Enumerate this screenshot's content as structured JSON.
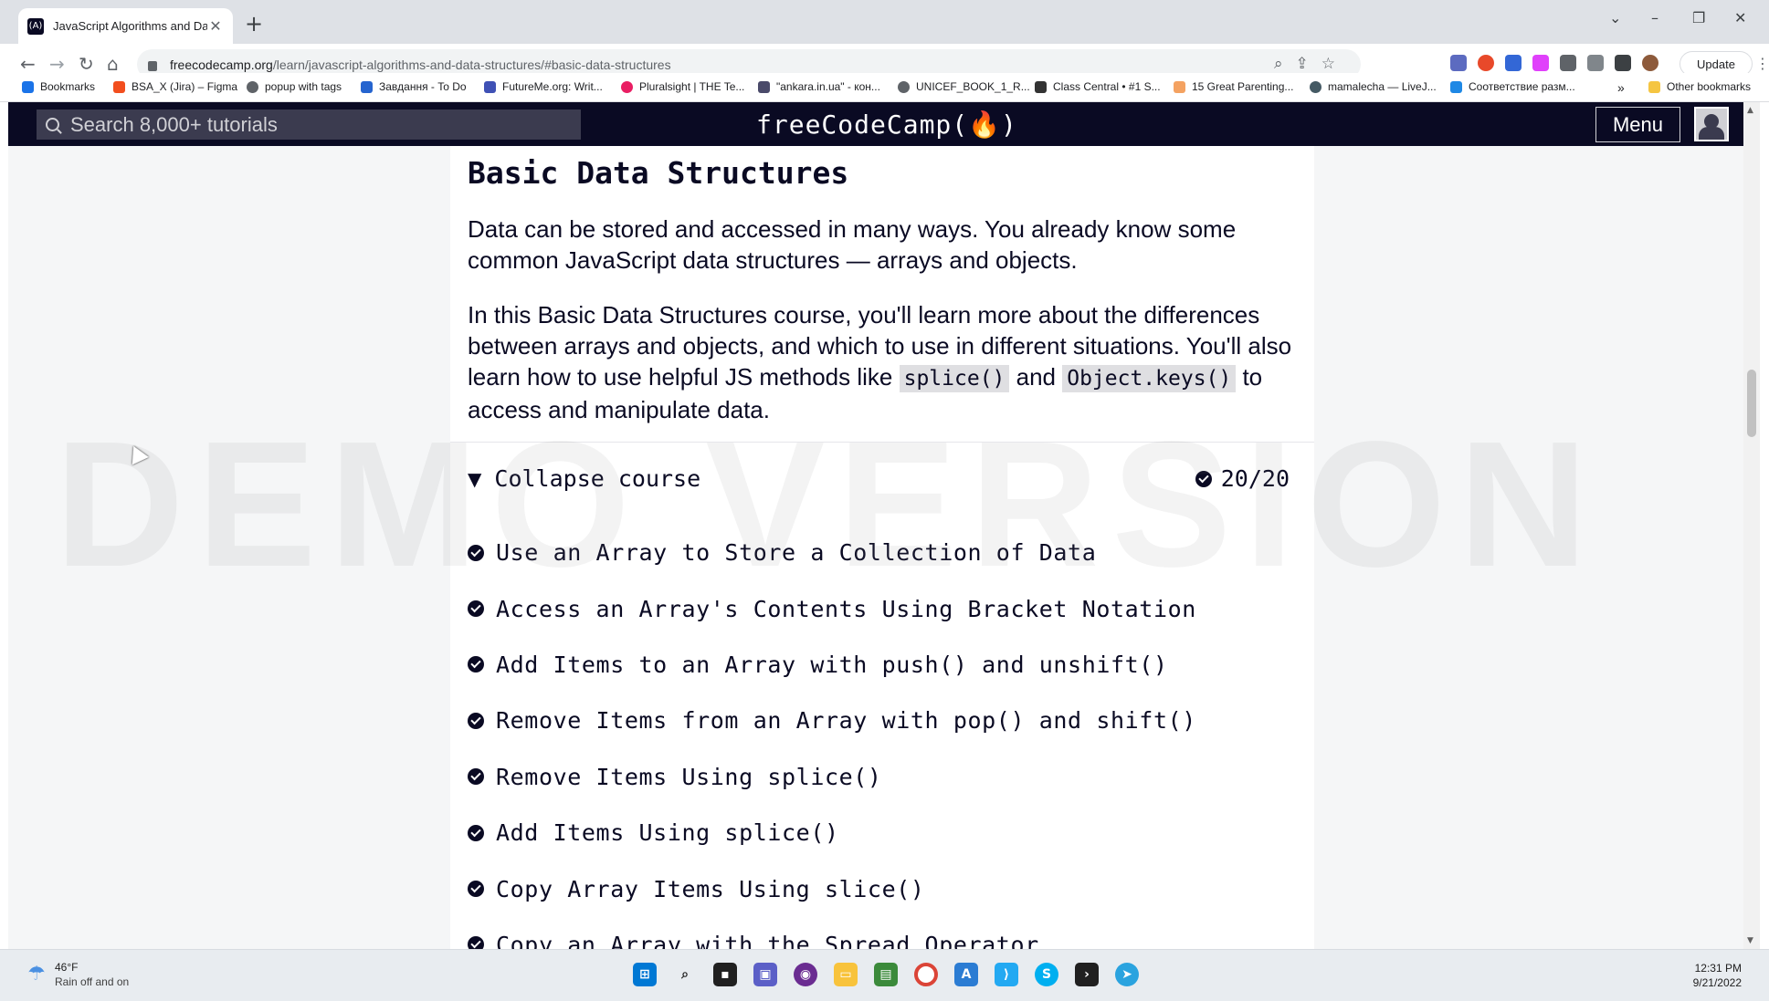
{
  "browser": {
    "tab_title": "JavaScript Algorithms and Data S",
    "url_domain": "freecodecamp.org",
    "url_path": "/learn/javascript-algorithms-and-data-structures/#basic-data-structures",
    "update_label": "Update",
    "bookmarks": [
      "Bookmarks",
      "BSA_X (Jira) – Figma",
      "popup with tags",
      "Завдання - To Do",
      "FutureMe.org: Writ...",
      "Pluralsight | THE Te...",
      "\"ankara.in.ua\" - кон...",
      "UNICEF_BOOK_1_R...",
      "Class Central • #1 S...",
      "15 Great Parenting...",
      "mamalecha — LiveJ...",
      "Соответствие разм..."
    ],
    "bookmarks_overflow": "»",
    "other_bookmarks": "Other bookmarks"
  },
  "fcc_nav": {
    "search_placeholder": "Search 8,000+ tutorials",
    "logo": "freeCodeCamp(🔥)",
    "menu_label": "Menu"
  },
  "course": {
    "title": "Basic Data Structures",
    "intro_1": "Data can be stored and accessed in many ways. You already know some common JavaScript data structures — arrays and objects.",
    "intro_2_a": "In this Basic Data Structures course, you'll learn more about the differences between arrays and objects, and which to use in different situations. You'll also learn how to use helpful JS methods like ",
    "code_1": "splice()",
    "intro_2_b": " and ",
    "code_2": "Object.keys()",
    "intro_2_c": " to access and manipulate data.",
    "collapse_label": "Collapse course",
    "progress": "20/20",
    "lessons": [
      "Use an Array to Store a Collection of Data",
      "Access an Array's Contents Using Bracket Notation",
      "Add Items to an Array with push() and unshift()",
      "Remove Items from an Array with pop() and shift()",
      "Remove Items Using splice()",
      "Add Items Using splice()",
      "Copy Array Items Using slice()",
      "Copy an Array with the Spread Operator"
    ]
  },
  "watermark": "DEMO VERSION",
  "taskbar": {
    "temperature": "46°F",
    "weather": "Rain off and on",
    "time": "12:31 PM",
    "date": "9/21/2022"
  }
}
